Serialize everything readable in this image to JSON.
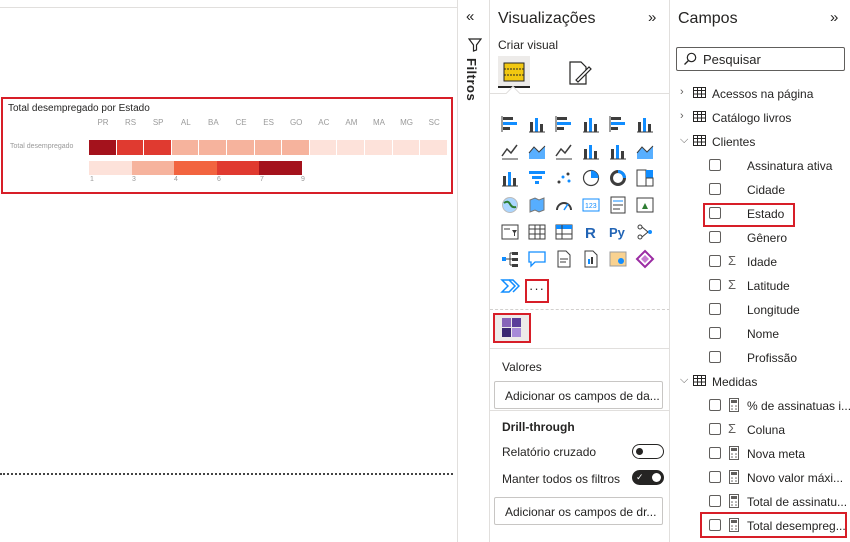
{
  "canvas": {
    "visual": {
      "title": "Total desempregado por Estado",
      "row_label": "Total desempregado",
      "states": [
        "PR",
        "RS",
        "SP",
        "AL",
        "BA",
        "CE",
        "ES",
        "GO",
        "AC",
        "AM",
        "MA",
        "MG",
        "SC"
      ],
      "heat_colors": [
        "#a4121c",
        "#e03a30",
        "#e03a30",
        "#f6b39d",
        "#f6b39d",
        "#f6b39d",
        "#f6b39d",
        "#f6b39d",
        "#fde2da",
        "#fde2da",
        "#fde2da",
        "#fde2da",
        "#fde2da"
      ],
      "legend": {
        "ticks": [
          "1",
          "3",
          "4",
          "6",
          "7",
          "9"
        ],
        "colors": [
          "#fde2da",
          "#f6b39d",
          "#f2643f",
          "#e03a30",
          "#a4121c"
        ]
      }
    }
  },
  "filters": {
    "label": "Filtros"
  },
  "visualizations": {
    "title": "Visualizações",
    "subtitle": "Criar visual",
    "more_label": "···",
    "values_label": "Valores",
    "values_well": "Adicionar os campos de da...",
    "drillthrough_label": "Drill-through",
    "cross_report_label": "Relatório cruzado",
    "keep_filters_label": "Manter todos os filtros",
    "drill_well": "Adicionar os campos de dr...",
    "icons": [
      "stacked-bar-icon",
      "stacked-column-icon",
      "clustered-bar-icon",
      "clustered-column-icon",
      "100-bar-icon",
      "100-column-icon",
      "line-chart-icon",
      "area-chart-icon",
      "stacked-area-icon",
      "line-column-icon",
      "line-clustered-icon",
      "ribbon-chart-icon",
      "waterfall-icon",
      "funnel-icon",
      "scatter-icon",
      "pie-icon",
      "donut-icon",
      "treemap-icon",
      "map-icon",
      "filled-map-icon",
      "gauge-icon",
      "card-icon",
      "multirow-card-icon",
      "kpi-icon",
      "slicer-icon",
      "table-icon",
      "matrix-icon",
      "r-visual-icon",
      "python-visual-icon",
      "key-influencers-icon",
      "decomposition-tree-icon",
      "qa-icon",
      "paginated-report-icon",
      "smart-narrative-icon",
      "arcgis-icon",
      "power-apps-icon",
      "power-automate-icon"
    ]
  },
  "fields": {
    "title": "Campos",
    "search_placeholder": "Pesquisar",
    "tables": [
      {
        "name": "Acessos na página",
        "expanded": false
      },
      {
        "name": "Catálogo livros",
        "expanded": false
      },
      {
        "name": "Clientes",
        "expanded": true
      },
      {
        "name": "Medidas",
        "expanded": true
      }
    ],
    "clientes_fields": [
      {
        "label": "Assinatura ativa",
        "icon": ""
      },
      {
        "label": "Cidade",
        "icon": ""
      },
      {
        "label": "Estado",
        "icon": ""
      },
      {
        "label": "Gênero",
        "icon": ""
      },
      {
        "label": "Idade",
        "icon": "Σ"
      },
      {
        "label": "Latitude",
        "icon": "Σ"
      },
      {
        "label": "Longitude",
        "icon": ""
      },
      {
        "label": "Nome",
        "icon": ""
      },
      {
        "label": "Profissão",
        "icon": ""
      }
    ],
    "medidas_fields": [
      {
        "label": "% de assinatuas i...",
        "icon": "calc"
      },
      {
        "label": "Coluna",
        "icon": "Σ"
      },
      {
        "label": "Nova meta",
        "icon": "calc"
      },
      {
        "label": "Novo valor máxi...",
        "icon": "calc"
      },
      {
        "label": "Total de assinatu...",
        "icon": "calc"
      },
      {
        "label": "Total desempreg...",
        "icon": "calc"
      }
    ]
  }
}
